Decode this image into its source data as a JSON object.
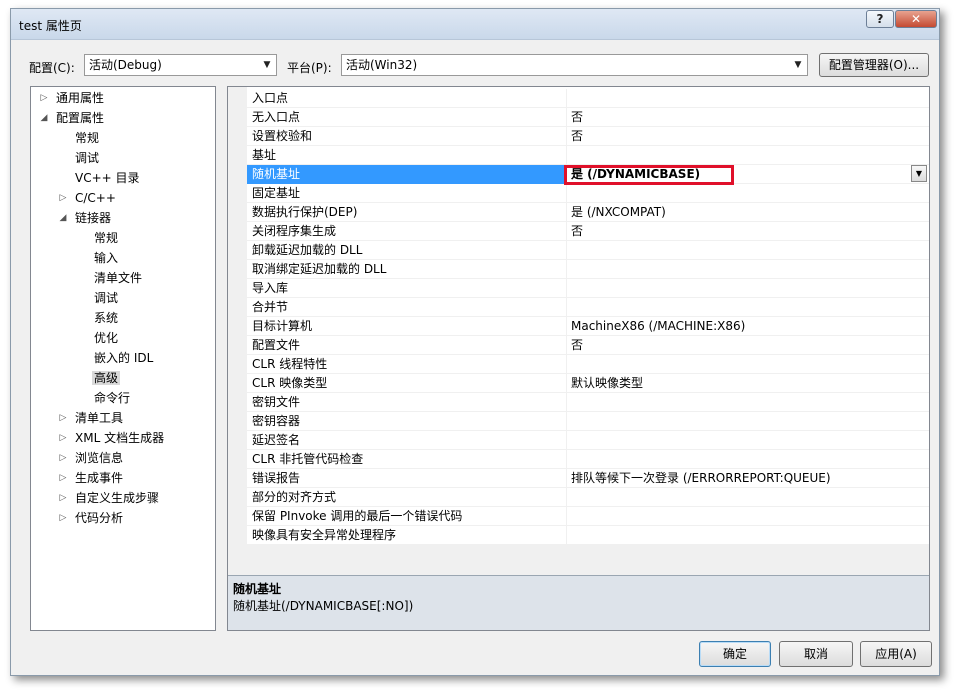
{
  "window": {
    "title": "test 属性页",
    "help_label": "?",
    "close_label": "✕"
  },
  "toolbar": {
    "config_label": "配置(C):",
    "config_value": "活动(Debug)",
    "platform_label": "平台(P):",
    "platform_value": "活动(Win32)",
    "config_manager_label": "配置管理器(O)..."
  },
  "tree": {
    "items": [
      {
        "label": "通用属性",
        "expander": "▷"
      },
      {
        "label": "配置属性",
        "expander": "◢"
      },
      {
        "label": "常规",
        "expander": ""
      },
      {
        "label": "调试",
        "expander": ""
      },
      {
        "label": "VC++ 目录",
        "expander": ""
      },
      {
        "label": "C/C++",
        "expander": "▷"
      },
      {
        "label": "链接器",
        "expander": "◢"
      },
      {
        "label": "常规",
        "expander": ""
      },
      {
        "label": "输入",
        "expander": ""
      },
      {
        "label": "清单文件",
        "expander": ""
      },
      {
        "label": "调试",
        "expander": ""
      },
      {
        "label": "系统",
        "expander": ""
      },
      {
        "label": "优化",
        "expander": ""
      },
      {
        "label": "嵌入的 IDL",
        "expander": ""
      },
      {
        "label": "高级",
        "expander": ""
      },
      {
        "label": "命令行",
        "expander": ""
      },
      {
        "label": "清单工具",
        "expander": "▷"
      },
      {
        "label": "XML 文档生成器",
        "expander": "▷"
      },
      {
        "label": "浏览信息",
        "expander": "▷"
      },
      {
        "label": "生成事件",
        "expander": "▷"
      },
      {
        "label": "自定义生成步骤",
        "expander": "▷"
      },
      {
        "label": "代码分析",
        "expander": "▷"
      }
    ]
  },
  "grid": {
    "rows": [
      {
        "name": "入口点",
        "value": ""
      },
      {
        "name": "无入口点",
        "value": "否"
      },
      {
        "name": "设置校验和",
        "value": "否"
      },
      {
        "name": "基址",
        "value": ""
      },
      {
        "name": "随机基址",
        "value": "是 (/DYNAMICBASE)"
      },
      {
        "name": "固定基址",
        "value": ""
      },
      {
        "name": "数据执行保护(DEP)",
        "value": "是 (/NXCOMPAT)"
      },
      {
        "name": "关闭程序集生成",
        "value": "否"
      },
      {
        "name": "卸载延迟加载的 DLL",
        "value": ""
      },
      {
        "name": "取消绑定延迟加载的 DLL",
        "value": ""
      },
      {
        "name": "导入库",
        "value": ""
      },
      {
        "name": "合并节",
        "value": ""
      },
      {
        "name": "目标计算机",
        "value": "MachineX86 (/MACHINE:X86)"
      },
      {
        "name": "配置文件",
        "value": "否"
      },
      {
        "name": "CLR 线程特性",
        "value": ""
      },
      {
        "name": "CLR 映像类型",
        "value": "默认映像类型"
      },
      {
        "name": "密钥文件",
        "value": ""
      },
      {
        "name": "密钥容器",
        "value": ""
      },
      {
        "name": "延迟签名",
        "value": ""
      },
      {
        "name": "CLR 非托管代码检查",
        "value": ""
      },
      {
        "name": "错误报告",
        "value": "排队等候下一次登录 (/ERRORREPORT:QUEUE)"
      },
      {
        "name": "部分的对齐方式",
        "value": ""
      },
      {
        "name": "保留 PInvoke 调用的最后一个错误代码",
        "value": ""
      },
      {
        "name": "映像具有安全异常处理程序",
        "value": ""
      }
    ],
    "dropdown_arrow": "▼"
  },
  "description": {
    "title": "随机基址",
    "text": "随机基址(/DYNAMICBASE[:NO])"
  },
  "footer": {
    "ok_label": "确定",
    "cancel_label": "取消",
    "apply_label": "应用(A)"
  },
  "colors": {
    "selection": "#3399ff",
    "highlight_box": "#e0102a",
    "description_bg": "#dde3ea"
  }
}
